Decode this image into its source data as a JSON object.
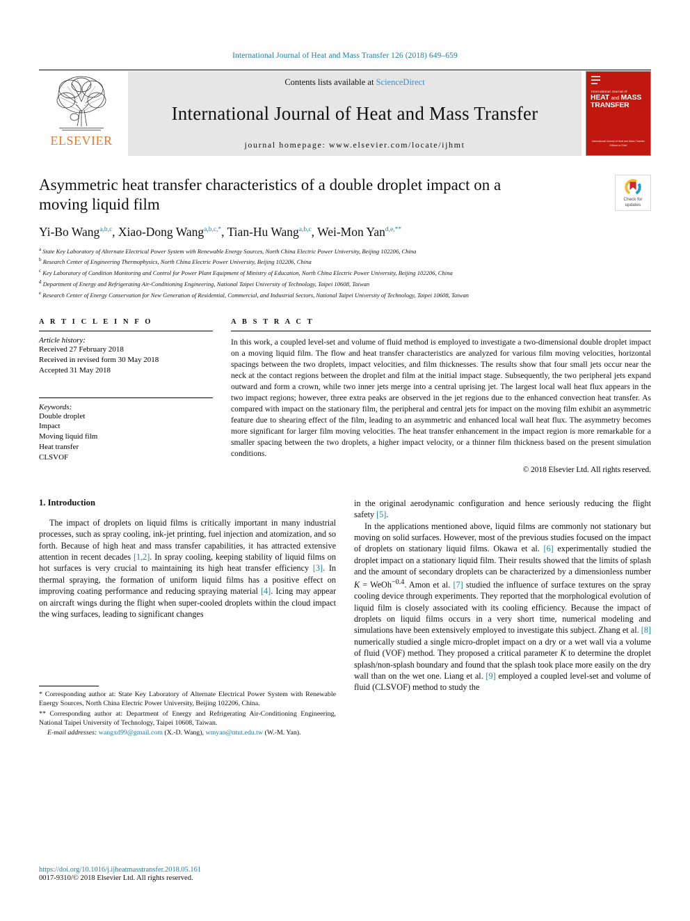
{
  "running_head": "International Journal of Heat and Mass Transfer 126 (2018) 649–659",
  "masthead": {
    "publisher_logo_text": "ELSEVIER",
    "contents_prefix": "Contents lists available at ",
    "contents_link": "ScienceDirect",
    "journal_name": "International Journal of Heat and Mass Transfer",
    "homepage_line": "journal homepage: www.elsevier.com/locate/ijhmt",
    "cover": {
      "superline": "International Journal of",
      "title_line1": "HEAT",
      "title_and": "and",
      "title_line1b": "MASS",
      "title_line2": "TRANSFER",
      "footer_line1": "International Journal of Heat and Mass Transfer",
      "footer_line2": "Editors-in-Chief"
    }
  },
  "title": {
    "line1": "Asymmetric heat transfer characteristics of a double droplet impact",
    "line2": "on a moving liquid film"
  },
  "crossmark": {
    "label_line1": "Check for",
    "label_line2": "updates",
    "name": "crossmark-check-for-updates-badge"
  },
  "authors": [
    {
      "name": "Yi-Bo Wang",
      "sup": "a,b,c",
      "sep": ", "
    },
    {
      "name": "Xiao-Dong Wang",
      "sup": "a,b,c,*",
      "sep": ", "
    },
    {
      "name": "Tian-Hu Wang",
      "sup": "a,b,c",
      "sep": ", "
    },
    {
      "name": "Wei-Mon Yan",
      "sup": "d,e,**",
      "sep": ""
    }
  ],
  "affiliations": [
    {
      "key": "a",
      "text": "State Key Laboratory of Alternate Electrical Power System with Renewable Energy Sources, North China Electric Power University, Beijing 102206, China"
    },
    {
      "key": "b",
      "text": "Research Center of Engineering Thermophysics, North China Electric Power University, Beijing 102206, China"
    },
    {
      "key": "c",
      "text": "Key Laboratory of Condition Monitoring and Control for Power Plant Equipment of Ministry of Education, North China Electric Power University, Beijing 102206, China"
    },
    {
      "key": "d",
      "text": "Department of Energy and Refrigerating Air-Conditioning Engineering, National Taipei University of Technology, Taipei 10608, Taiwan"
    },
    {
      "key": "e",
      "text": "Research Center of Energy Conservation for New Generation of Residential, Commercial, and Industrial Sectors, National Taipei University of Technology, Taipei 10608, Taiwan"
    }
  ],
  "article_info": {
    "heading": "A R T I C L E   I N F O",
    "history_label": "Article history:",
    "history": [
      "Received 27 February 2018",
      "Received in revised form 30 May 2018",
      "Accepted 31 May 2018"
    ],
    "keywords_label": "Keywords:",
    "keywords": [
      "Double droplet",
      "Impact",
      "Moving liquid film",
      "Heat transfer",
      "CLSVOF"
    ]
  },
  "abstract": {
    "heading": "A B S T R A C T",
    "text": "In this work, a coupled level-set and volume of fluid method is employed to investigate a two-dimensional double droplet impact on a moving liquid film. The flow and heat transfer characteristics are analyzed for various film moving velocities, horizontal spacings between the two droplets, impact velocities, and film thicknesses. The results show that four small jets occur near the neck at the contact regions between the droplet and film at the initial impact stage. Subsequently, the two peripheral jets expand outward and form a crown, while two inner jets merge into a central uprising jet. The largest local wall heat flux appears in the two impact regions; however, three extra peaks are observed in the jet regions due to the enhanced convection heat transfer. As compared with impact on the stationary film, the peripheral and central jets for impact on the moving film exhibit an asymmetric feature due to shearing effect of the film, leading to an asymmetric and enhanced local wall heat flux. The asymmetry becomes more significant for larger film moving velocities. The heat transfer enhancement in the impact region is more remarkable for a smaller spacing between the two droplets, a higher impact velocity, or a thinner film thickness based on the present simulation conditions.",
    "copyright": "© 2018 Elsevier Ltd. All rights reserved."
  },
  "introduction": {
    "heading": "1. Introduction",
    "left_p1_a": "The impact of droplets on liquid films is critically important in many industrial processes, such as spray cooling, ink-jet printing, fuel injection and atomization, and so forth. Because of high heat and mass transfer capabilities, it has attracted extensive attention in recent decades ",
    "left_ref1": "[1,2]",
    "left_p1_b": ". In spray cooling, keeping stability of liquid films on hot surfaces is very crucial to maintaining its high heat transfer efficiency ",
    "left_ref2": "[3]",
    "left_p1_c": ". In thermal spraying, the formation of uniform liquid films has a positive effect on improving coating performance and reducing spraying material ",
    "left_ref3": "[4]",
    "left_p1_d": ". Icing may appear on aircraft wings during the flight when super-cooled droplets within the cloud impact the wing surfaces, leading to significant changes",
    "right_p1_a": "in the original aerodynamic configuration and hence seriously reducing the flight safety ",
    "right_ref5": "[5]",
    "right_p1_b": ".",
    "right_p2_a": "In the applications mentioned above, liquid films are commonly not stationary but moving on solid surfaces. However, most of the previous studies focused on the impact of droplets on stationary liquid films. Okawa et al. ",
    "right_ref6": "[6]",
    "right_p2_b": " experimentally studied the droplet impact on a stationary liquid film. Their results showed that the limits of splash and the amount of secondary droplets can be characterized by a dimensionless number ",
    "right_eq_K": "K",
    "right_eq_eq": " = WeOh",
    "right_eq_exp": "−0.4",
    "right_p2_c": ". Amon et al. ",
    "right_ref7": "[7]",
    "right_p2_d": " studied the influence of surface textures on the spray cooling device through experiments. They reported that the morphological evolution of liquid film is closely associated with its cooling efficiency. Because the impact of droplets on liquid films occurs in a very short time, numerical modeling and simulations have been extensively employed to investigate this subject. Zhang et al. ",
    "right_ref8": "[8]",
    "right_p2_e": " numerically studied a single micro-droplet impact on a dry or a wet wall via a volume of fluid (VOF) method. They proposed a critical parameter ",
    "right_param_K": "K",
    "right_p2_f": " to determine the droplet splash/non-splash boundary and found that the splash took place more easily on the dry wall than on the wet one. Liang et al. ",
    "right_ref9": "[9]",
    "right_p2_g": " employed a coupled level-set and volume of fluid (CLSVOF) method to study the"
  },
  "footnotes": {
    "fn1_marker": "*",
    "fn1_text": " Corresponding author at: State Key Laboratory of Alternate Electrical Power System with Renewable Energy Sources, North China Electric Power University, Beijing 102206, China.",
    "fn2_marker": "**",
    "fn2_text": " Corresponding author at: Department of Energy and Refrigerating Air-Conditioning Engineering, National Taipei University of Technology, Taipei 10608, Taiwan.",
    "email_label": "E-mail addresses:",
    "email1": "wangxd99@gmail.com",
    "email1_owner": " (X.-D. Wang), ",
    "email2": "wmyan@ntut.edu.tw",
    "email2_owner": " (W.-M. Yan)."
  },
  "footer": {
    "doi": "https://doi.org/10.1016/j.ijheatmasstransfer.2018.05.161",
    "issn": "0017-9310/© 2018 Elsevier Ltd. All rights reserved."
  },
  "colors": {
    "link": "#1b7fa8",
    "sciencedirect": "#3a8fd0",
    "elsevier_orange": "#e8792a",
    "cover_red": "#c0180f",
    "masthead_gray": "#e6e6e6"
  }
}
